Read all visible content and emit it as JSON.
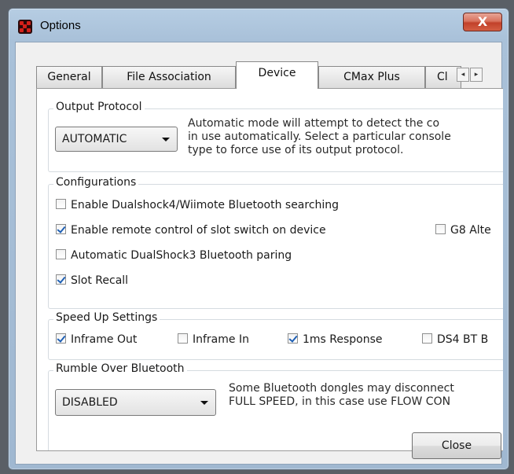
{
  "window": {
    "title": "Options",
    "close_glyph": "X",
    "titlebar_color": "#a9c1d9",
    "close_color": "#c2412a"
  },
  "tabs": [
    {
      "label": "General"
    },
    {
      "label": "File Association"
    },
    {
      "label": "Device",
      "active": true
    },
    {
      "label": "CMax Plus"
    },
    {
      "label": "Cl"
    }
  ],
  "tab_scroll": {
    "left": "◂",
    "right": "▸"
  },
  "output_protocol": {
    "legend": "Output Protocol",
    "selected": "AUTOMATIC",
    "description": [
      "Automatic mode will attempt to detect the co",
      "in use automatically. Select a particular console",
      "type to force use of its output protocol."
    ]
  },
  "configurations": {
    "legend": "Configurations",
    "items": [
      {
        "label": "Enable Dualshock4/Wiimote Bluetooth searching",
        "checked": false
      },
      {
        "label": "Enable remote control of slot switch on device",
        "checked": true
      },
      {
        "label": "G8 Alte",
        "checked": false
      },
      {
        "label": "Automatic DualShock3 Bluetooth paring",
        "checked": false
      },
      {
        "label": "Slot Recall",
        "checked": true
      }
    ]
  },
  "speed_up": {
    "legend": "Speed Up Settings",
    "items": [
      {
        "label": "Inframe Out",
        "checked": true
      },
      {
        "label": "Inframe In",
        "checked": false
      },
      {
        "label": "1ms Response",
        "checked": true
      },
      {
        "label": "DS4 BT B",
        "checked": false
      }
    ]
  },
  "rumble": {
    "legend": "Rumble Over Bluetooth",
    "selected": "DISABLED",
    "description": [
      "Some Bluetooth dongles may disconnect",
      "FULL SPEED, in this case use FLOW CON"
    ]
  },
  "footer": {
    "close_label": "Close"
  }
}
